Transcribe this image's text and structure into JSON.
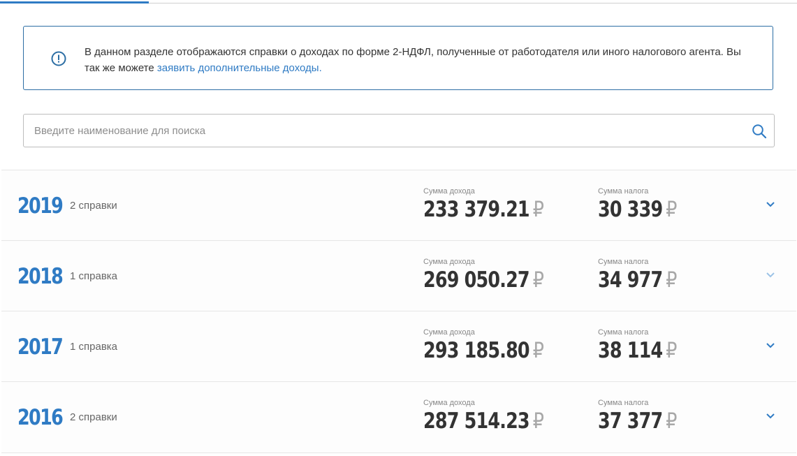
{
  "info": {
    "text": "В данном разделе отображаются справки о доходах по форме 2-НДФЛ, полученные от работодателя или иного налогового агента. Вы так же можете ",
    "link": "заявить дополнительные доходы."
  },
  "search": {
    "placeholder": "Введите наименование для поиска"
  },
  "labels": {
    "income": "Сумма дохода",
    "tax": "Сумма налога",
    "currency": "₽"
  },
  "years": [
    {
      "year": "2019",
      "count": "2 справки",
      "income": "233 379.21",
      "tax": "30 339"
    },
    {
      "year": "2018",
      "count": "1 справка",
      "income": "269 050.27",
      "tax": "34 977"
    },
    {
      "year": "2017",
      "count": "1 справка",
      "income": "293 185.80",
      "tax": "38 114"
    },
    {
      "year": "2016",
      "count": "2 справки",
      "income": "287 514.23",
      "tax": "37 377"
    }
  ],
  "colors": {
    "accent": "#2f7bc4",
    "border": "#2c6ea4",
    "chevron_light": "#9cc3e6"
  }
}
